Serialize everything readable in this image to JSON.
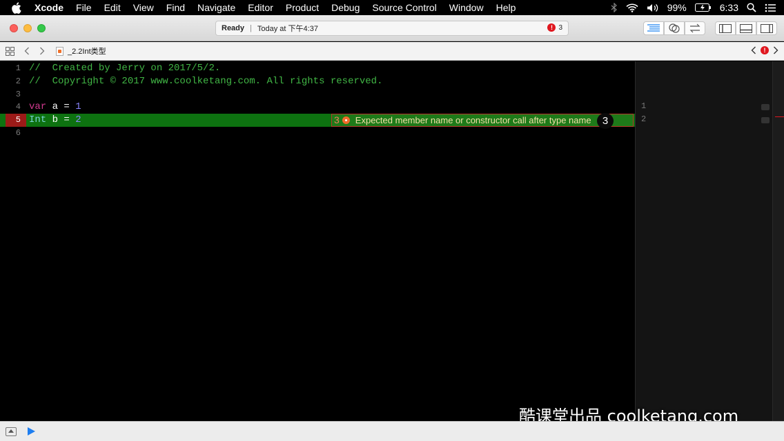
{
  "menubar": {
    "app": "Xcode",
    "items": [
      "File",
      "Edit",
      "View",
      "Find",
      "Navigate",
      "Editor",
      "Product",
      "Debug",
      "Source Control",
      "Window",
      "Help"
    ],
    "battery": "99%",
    "time": "6:33"
  },
  "toolbar": {
    "status": "Ready",
    "timestamp": "Today at 下午4:37",
    "error_count": "3",
    "error_icon": "!"
  },
  "jumpbar": {
    "file_name": "_2.2Int类型"
  },
  "editor": {
    "lines": [
      {
        "num": "1",
        "comment": "//  Created by Jerry on 2017/5/2."
      },
      {
        "num": "2",
        "comment": "//  Copyright © 2017 www.coolketang.com. All rights reserved."
      },
      {
        "num": "3"
      },
      {
        "num": "4",
        "keyword": "var",
        "ident": " a = ",
        "value": "1"
      },
      {
        "num": "5",
        "type": "Int",
        "ident": " b = ",
        "value": "2"
      },
      {
        "num": "6"
      }
    ],
    "issue": {
      "count": "3",
      "message": "Expected member name or constructor call after type name",
      "badge": "3"
    }
  },
  "sidepane": {
    "line_numbers": [
      "1",
      "2"
    ]
  },
  "watermark": "酷课堂出品 coolketang.com",
  "colors": {
    "comment": "#41b645",
    "keyword": "#d23a8f",
    "number": "#8b87ff",
    "type": "#79d3d9",
    "error_line": "#0d7210",
    "error_red": "#e0171f"
  }
}
